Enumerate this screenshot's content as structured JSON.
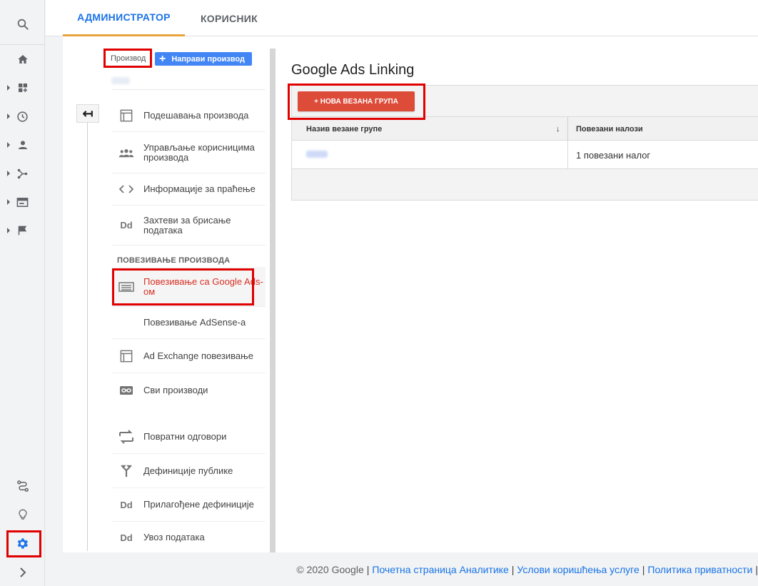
{
  "tabs": [
    {
      "label": "АДМИНИСТРАТОР",
      "active": true
    },
    {
      "label": "КОРИСНИК",
      "active": false
    }
  ],
  "property": {
    "label": "Производ",
    "create_button": "Направи производ"
  },
  "menu": {
    "items": [
      {
        "label": "Подешавања производа",
        "icon": "property-settings-icon"
      },
      {
        "label": "Управљање корисницима производа",
        "icon": "users-icon"
      },
      {
        "label": "Информације за праћење",
        "icon": "code-icon"
      },
      {
        "label": "Захтеви за брисање података",
        "icon": "dd-icon",
        "icon_text": "Dd"
      }
    ],
    "section_header": "ПОВЕЗИВАЊЕ ПРОИЗВОДА",
    "link_items": [
      {
        "label": "Повезивање са Google Ads-ом",
        "icon": "google-ads-icon",
        "selected": true
      },
      {
        "label": "Повезивање AdSense-а",
        "icon": ""
      },
      {
        "label": "Ad Exchange повезивање",
        "icon": "ad-exchange-icon"
      },
      {
        "label": "Сви производи",
        "icon": "link-icon"
      }
    ],
    "other_items": [
      {
        "label": "Повратни одговори",
        "icon": "postbacks-icon"
      },
      {
        "label": "Дефиниције публике",
        "icon": "audience-icon"
      },
      {
        "label": "Прилагођене дефиниције",
        "icon": "dd-icon",
        "icon_text": "Dd"
      },
      {
        "label": "Увоз података",
        "icon": "dd-icon",
        "icon_text": "Dd"
      }
    ]
  },
  "content": {
    "title": "Google Ads Linking",
    "new_group_button": "+ НОВА ВЕЗАНА ГРУПА",
    "table": {
      "columns": [
        "Назив везане групе",
        "Повезани налози"
      ],
      "rows": [
        {
          "name": "",
          "linked": "1 повезани налог"
        }
      ]
    }
  },
  "footer": {
    "copyright": "© 2020 Google",
    "links": [
      "Почетна страница Аналитике",
      "Услови коришћења услуге",
      "Политика приватности"
    ]
  },
  "colors": {
    "accent_blue": "#1a73e8",
    "tab_underline": "#e8a33d",
    "primary_red": "#dd4b39",
    "highlight_red": "#e00000"
  }
}
